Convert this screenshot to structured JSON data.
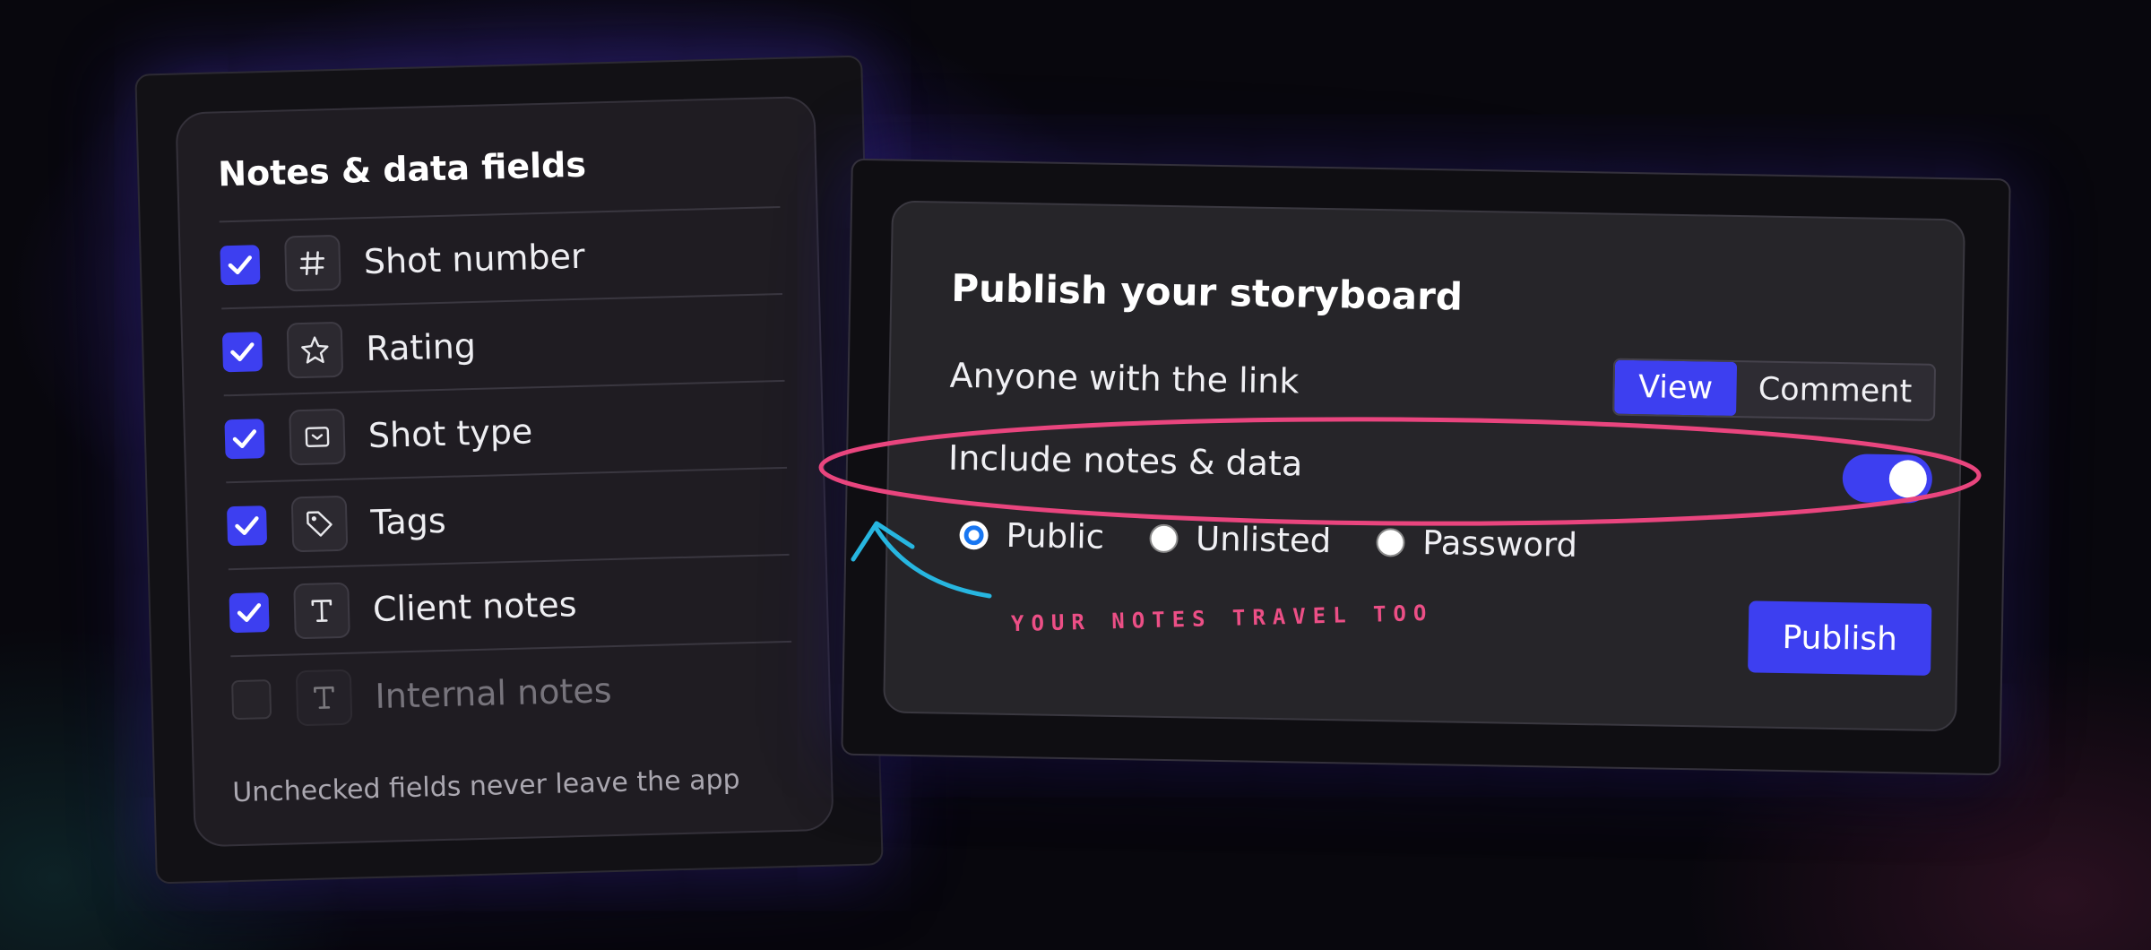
{
  "fields_panel": {
    "title": "Notes & data fields",
    "fields": [
      {
        "label": "Shot number",
        "checked": true,
        "icon": "hash-icon"
      },
      {
        "label": "Rating",
        "checked": true,
        "icon": "star-icon"
      },
      {
        "label": "Shot type",
        "checked": true,
        "icon": "shot-type-icon"
      },
      {
        "label": "Tags",
        "checked": true,
        "icon": "tag-icon"
      },
      {
        "label": "Client notes",
        "checked": true,
        "icon": "text-icon"
      },
      {
        "label": "Internal notes",
        "checked": false,
        "icon": "text-icon"
      }
    ],
    "footer": "Unchecked fields never leave the app"
  },
  "publish_panel": {
    "title": "Publish your storyboard",
    "link_label": "Anyone with the link",
    "access_options": [
      "View",
      "Comment"
    ],
    "access_selected": "View",
    "include_notes_label": "Include notes & data",
    "include_notes_on": true,
    "visibility_options": [
      "Public",
      "Unlisted",
      "Password"
    ],
    "visibility_selected": "Public",
    "publish_label": "Publish"
  },
  "annotation": {
    "text": "YOUR NOTES TRAVEL TOO"
  },
  "colors": {
    "accent": "#3d3ff0",
    "highlight": "#e9457e",
    "arrow": "#27b6e0",
    "radio_selected": "#1877f2"
  }
}
